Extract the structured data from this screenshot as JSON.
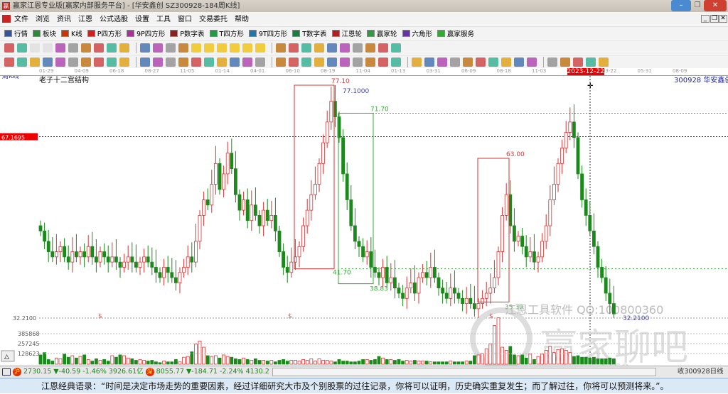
{
  "window": {
    "title": "赢家江恩专业版[赢家内部服务平台] - [华安鑫创  SZ300928-184周K线]",
    "logo": "赢"
  },
  "menu": [
    "文件",
    "浏览",
    "资讯",
    "江恩",
    "公式选股",
    "设置",
    "工具",
    "窗口",
    "交易委托",
    "帮助"
  ],
  "toolbar1": [
    {
      "label": "行情",
      "icon": "grid-icon",
      "color": "#335599"
    },
    {
      "label": "板块",
      "icon": "blocks-icon",
      "color": "#2a8a3a"
    },
    {
      "label": "K线",
      "icon": "candles-icon",
      "color": "#cc3300"
    },
    {
      "label": "P四方形",
      "icon": "p-square-icon",
      "color": "#cc2222"
    },
    {
      "label": "9P四方形",
      "icon": "9p-square-icon",
      "color": "#aa3399"
    },
    {
      "label": "P数字表",
      "icon": "p-table-icon",
      "color": "#882222"
    },
    {
      "label": "T四方形",
      "icon": "t-square-icon",
      "color": "#229944"
    },
    {
      "label": "9T四方形",
      "icon": "9t-square-icon",
      "color": "#2277aa"
    },
    {
      "label": "T数字表",
      "icon": "t-table-icon",
      "color": "#227744"
    },
    {
      "label": "江恩轮",
      "icon": "gann-wheel-icon",
      "color": "#aa2222"
    },
    {
      "label": "赢家轮",
      "icon": "winner-wheel-icon",
      "color": "#339944"
    },
    {
      "label": "六角形",
      "icon": "hexagon-icon",
      "color": "#6633aa"
    },
    {
      "label": "赢家服务",
      "icon": "dollar-icon",
      "color": "#33aa33"
    }
  ],
  "toolbar2_icons": [
    "save-icon",
    "dropdown-icon",
    "disabled-icon",
    "disabled-icon",
    "chart-icon",
    "chart-icon",
    "cursor-icon",
    "dropdown-icon",
    "stamp-icon",
    "flag-icon",
    "first-icon",
    "last-icon",
    "left-icon",
    "right-icon",
    "diamond-icon",
    "diamond-icon",
    "diamond-icon",
    "diamond-icon",
    "diamond-icon",
    "diamond-icon",
    "hand-icon",
    "crosshair-icon",
    "line-icon",
    "node-icon",
    "gear-icon",
    "calendar-icon",
    "calculator-icon",
    "notes-icon",
    "disk-icon",
    "truck-icon"
  ],
  "toolbar3_icons": [
    "pen-icon",
    "hash-icon",
    "gold-icon",
    "gold-icon",
    "fork-icon",
    "fork-icon",
    "marker-icon",
    "circle-icon",
    "lines-icon",
    "n2-icon",
    "fan-icon",
    "target-icon",
    "star-icon",
    "box-icon",
    "wave-icon",
    "pitch-icon",
    "pitch-icon",
    "grid-icon",
    "range-icon",
    "rect-icon",
    "fan-icon",
    "square-icon",
    "square-icon",
    "angle-icon",
    "v-icon",
    "grid-icon",
    "grid-icon",
    "lines-icon",
    "e-icon",
    "percent-icon",
    "percent-icon",
    "lines-icon",
    "coin-icon",
    "lines-icon",
    "arrow-icon",
    "box-icon",
    "gold-icon",
    "angle-icon",
    "angle-icon",
    "angle-icon",
    "angle-icon",
    "angle-icon",
    "angle-icon",
    "yinyang-icon",
    "infinity-icon"
  ],
  "date_axis": [
    "01-29",
    "04-09",
    "06-18",
    "08-27",
    "11-05",
    "01-14",
    "04-01",
    "06-10",
    "08-19",
    "11-04",
    "01-13",
    "03-31",
    "06-09",
    "08-18",
    "11-03",
    "2023-12-22",
    "03-22",
    "05-31",
    "08-09"
  ],
  "chart_labels": {
    "period": "周K线",
    "indicator": "老子十二宫结构",
    "symbol": "300928  华安鑫创",
    "current_price": "67.1695",
    "low_price": "32.2100",
    "low_marker": "32.2100",
    "high_marker": "77.1000",
    "dollar": "$",
    "vol_ticks": [
      "385868",
      "257245",
      "128623"
    ]
  },
  "watermark": {
    "line1": "江恩工具软件  QQ:100800360",
    "line2": "赢家聊吧",
    "line3": "liaoba.yjcl360.com"
  },
  "chart_data": {
    "type": "candlestick",
    "title": "300928 华安鑫创 周K线",
    "ylim": [
      32.21,
      77.1
    ],
    "closes": [
      49,
      47,
      45,
      44,
      45,
      46,
      44,
      43,
      45,
      44,
      45,
      44,
      46,
      44,
      43,
      45,
      44,
      43,
      44,
      43,
      42,
      43,
      44,
      43,
      42,
      43,
      44,
      43,
      42,
      41,
      40,
      42,
      41,
      40,
      39,
      41,
      42,
      44,
      43,
      47,
      52,
      55,
      54,
      58,
      62,
      57,
      60,
      64,
      61,
      56,
      53,
      55,
      51,
      54,
      52,
      50,
      53,
      51,
      52,
      49,
      45,
      42,
      41,
      43,
      44,
      46,
      50,
      53,
      56,
      58,
      62,
      66,
      70,
      74,
      71,
      67,
      60,
      55,
      50,
      47,
      46,
      44,
      45,
      42,
      41,
      40,
      42,
      39,
      40,
      38,
      37,
      36,
      38,
      39,
      37,
      40,
      41,
      40,
      42,
      40,
      38,
      37,
      36,
      38,
      37,
      36,
      35,
      36,
      35,
      34,
      35,
      36,
      37,
      38,
      40,
      45,
      52,
      56,
      50,
      47,
      48,
      46,
      44,
      45,
      43,
      44,
      47,
      50,
      55,
      58,
      62,
      65,
      68,
      70,
      67,
      60,
      55,
      52,
      49,
      46,
      42,
      40,
      37,
      35,
      33
    ],
    "volumes": [
      120,
      150,
      60,
      40,
      80,
      70,
      130,
      90,
      110,
      80,
      100,
      120,
      60,
      40,
      70,
      50,
      60,
      40,
      110,
      90,
      120,
      110,
      80,
      70,
      50,
      60,
      50,
      40,
      50,
      30,
      20,
      40,
      30,
      30,
      60,
      30,
      90,
      100,
      160,
      260,
      300,
      220,
      110,
      100,
      110,
      80,
      120,
      100,
      90,
      70,
      60,
      80,
      60,
      50,
      70,
      50,
      50,
      40,
      50,
      30,
      50,
      60,
      40,
      50,
      50,
      40,
      60,
      50,
      70,
      40,
      70,
      50,
      50,
      40,
      30,
      60,
      40,
      40,
      30,
      30,
      40,
      60,
      60,
      50,
      60,
      100,
      80,
      60,
      60,
      50,
      60,
      40,
      50,
      40,
      50,
      40,
      40,
      40,
      30,
      30,
      30,
      30,
      30,
      40,
      30,
      30,
      30,
      40,
      40,
      110,
      120,
      140,
      200,
      260,
      500,
      600,
      220,
      180,
      230,
      120,
      110,
      120,
      80,
      130,
      60,
      100,
      130,
      180,
      230,
      150,
      190,
      200,
      180,
      150,
      100,
      110,
      90,
      90,
      80,
      90,
      70,
      70,
      70,
      80,
      70
    ],
    "volume_unit_note": "thousands",
    "annotations": [
      {
        "type": "box",
        "color": "#d33",
        "high": 77.1,
        "low": 41.7,
        "high_label": "77.10",
        "low_label": "41.70"
      },
      {
        "type": "box",
        "color": "#3a3",
        "high": 71.7,
        "low": 38.83,
        "high_label": "71.70",
        "low_label": "38.83"
      },
      {
        "type": "box",
        "color": "#d33",
        "high": 63.0,
        "low": 35.3,
        "high_label": "63.00",
        "low_label": "35.30"
      }
    ],
    "selected_date": "2023-12-22"
  },
  "status": {
    "sh_badge": "沪",
    "sh": "2730.15 ▼-40.59 -1.46% 3926.61亿",
    "sz_badge": "深",
    "sz": "8055.77 ▼-184.71 -2.24% 4130.2",
    "right": "收300928日线"
  },
  "quote": "江恩经典语录：“时间是决定市场走势的重要因素，经过详细研究大市及个别股票的过往记录，你将可以证明，历史确实重复发生；而了解过往，你将可以预测将来。”。",
  "colors": {
    "up": "#d33",
    "down": "#1a8a1a",
    "accent": "#e00"
  }
}
